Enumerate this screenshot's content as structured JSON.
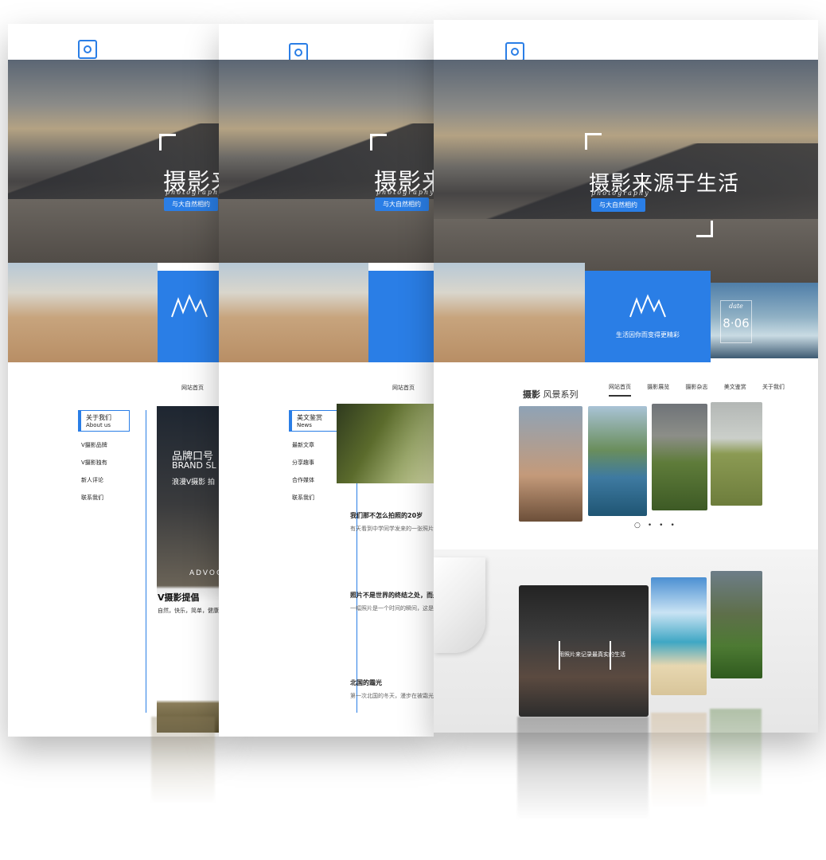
{
  "colors": {
    "accent": "#2a7ee6",
    "text": "#333333"
  },
  "hero": {
    "title": "摄影来源于生活",
    "title_short_1": "摄影来源",
    "title_short_2": "摄影来源",
    "subtitle": "photography",
    "button": "与大自然相约"
  },
  "blue_panel": {
    "caption": "生活因你而变得更精彩"
  },
  "date_card": {
    "label": "date",
    "value": "8·06"
  },
  "nav": {
    "items": [
      "网站首页",
      "摄影展览",
      "摄影杂志",
      "美文鉴赏",
      "关于我们"
    ]
  },
  "section": {
    "title_bold": "摄影",
    "title": "风景系列"
  },
  "sidebar1": {
    "head": "关于我们",
    "head_en": "About us",
    "items": [
      "V摄影品牌",
      "V摄影独有",
      "新人评论",
      "联系我们"
    ]
  },
  "sidebar2": {
    "head": "美文鉴赏",
    "head_en": "News",
    "items": [
      "最新文章",
      "分享趣事",
      "合作媒体",
      "联系我们"
    ]
  },
  "ad": {
    "line1": "品牌口号",
    "line2": "BRAND SL",
    "line3": "浪漫V摄影 拍",
    "band": "ADVOCA",
    "title": "V摄影提倡",
    "body": "自然，快乐，简单，健康，"
  },
  "articles": [
    {
      "title": "我们那不怎么拍照的20岁",
      "body": "有天看到中学同学发来的一张照片，说那时候..."
    },
    {
      "title": "照片不是世界的终结之处，而是开",
      "body": "一幅照片是一个时间的瞬间，这是我学习摄影..."
    },
    {
      "title": "北国的霜光",
      "body": "第一次北国的冬天，漫步在被霜光覆盖的山野..."
    }
  ],
  "photo_banner": {
    "caption": "用照片来记录最真实的生活"
  }
}
